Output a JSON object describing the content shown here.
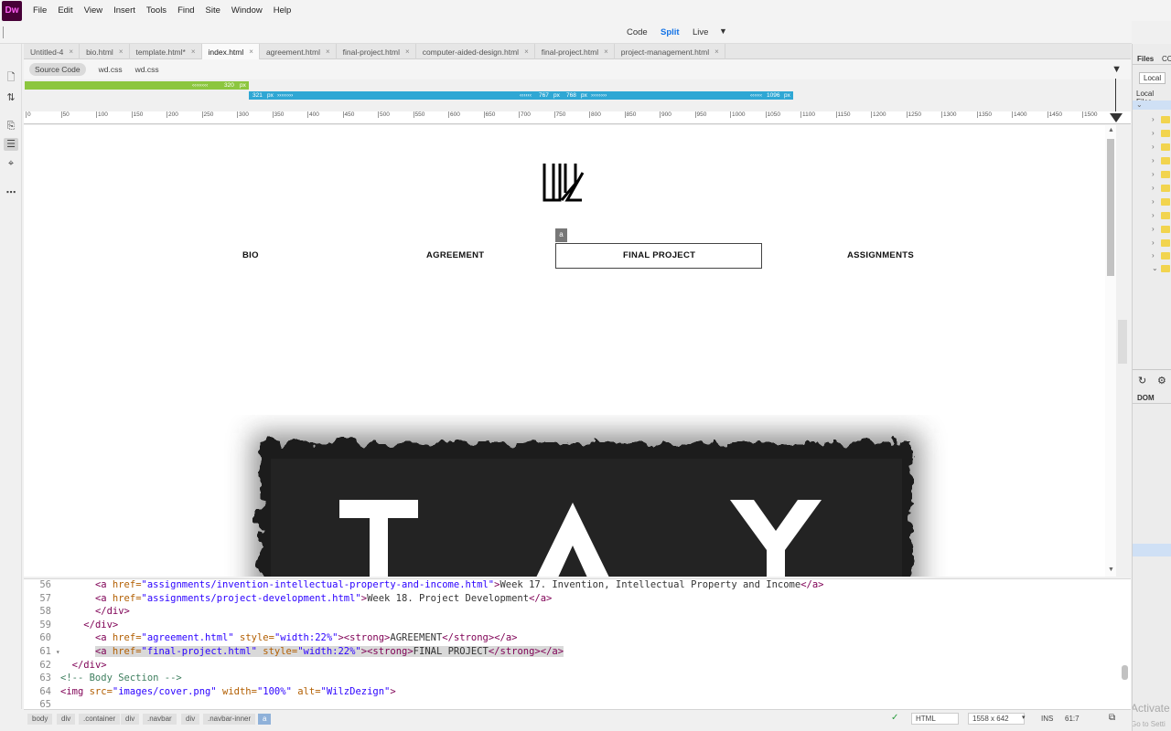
{
  "app": {
    "logo": "Dw"
  },
  "menu": [
    "File",
    "Edit",
    "View",
    "Insert",
    "Tools",
    "Find",
    "Site",
    "Window",
    "Help"
  ],
  "views": {
    "code": "Code",
    "split": "Split",
    "live": "Live"
  },
  "tabs": [
    {
      "label": "Untitled-4",
      "active": false
    },
    {
      "label": "bio.html",
      "active": false
    },
    {
      "label": "template.html*",
      "active": false
    },
    {
      "label": "index.html",
      "active": true
    },
    {
      "label": "agreement.html",
      "active": false
    },
    {
      "label": "final-project.html",
      "active": false
    },
    {
      "label": "computer-aided-design.html",
      "active": false
    },
    {
      "label": "final-project.html",
      "active": false
    },
    {
      "label": "project-management.html",
      "active": false
    }
  ],
  "related_files": [
    "Source Code",
    "wd.css",
    "wd.css"
  ],
  "media_queries": {
    "bar1": {
      "end": "320",
      "unit": "px"
    },
    "bar2": {
      "start": "321",
      "mid_end": "767",
      "mid_start": "768",
      "end": "1096",
      "unit": "px"
    }
  },
  "ruler_ticks": [
    "0",
    "50",
    "100",
    "150",
    "200",
    "250",
    "300",
    "350",
    "400",
    "450",
    "500",
    "550",
    "600",
    "650",
    "700",
    "750",
    "800",
    "850",
    "900",
    "950",
    "1000",
    "1050",
    "1100",
    "1150",
    "1200",
    "1250",
    "1300",
    "1350",
    "1400",
    "1450",
    "1500"
  ],
  "live": {
    "nav": [
      "BIO",
      "AGREEMENT",
      "FINAL PROJECT",
      "ASSIGNMENTS"
    ],
    "badge": "a",
    "cover_text": [
      "T",
      "A",
      "Y"
    ]
  },
  "code_lines": [
    {
      "num": "56",
      "fold": false,
      "indent": "      ",
      "parts": [
        [
          "t",
          "<a "
        ],
        [
          "a",
          "href="
        ],
        [
          "s",
          "\"assignments/invention-intellectual-property-and-income.html\""
        ],
        [
          "t",
          ">"
        ],
        [
          "x",
          "Week 17. Invention, Intellectual Property and Income"
        ],
        [
          "t",
          "</a>"
        ]
      ]
    },
    {
      "num": "57",
      "fold": false,
      "indent": "      ",
      "parts": [
        [
          "t",
          "<a "
        ],
        [
          "a",
          "href="
        ],
        [
          "s",
          "\"assignments/project-development.html\""
        ],
        [
          "t",
          ">"
        ],
        [
          "x",
          "Week 18. Project Development"
        ],
        [
          "t",
          "</a>"
        ]
      ]
    },
    {
      "num": "58",
      "fold": false,
      "indent": "      ",
      "parts": [
        [
          "t",
          "</div>"
        ]
      ]
    },
    {
      "num": "59",
      "fold": false,
      "indent": "    ",
      "parts": [
        [
          "t",
          "</div>"
        ]
      ]
    },
    {
      "num": "60",
      "fold": false,
      "indent": "      ",
      "parts": [
        [
          "t",
          "<a "
        ],
        [
          "a",
          "href="
        ],
        [
          "s",
          "\"agreement.html\""
        ],
        [
          "a",
          " style="
        ],
        [
          "s",
          "\"width:22%\""
        ],
        [
          "t",
          "><strong>"
        ],
        [
          "x",
          "AGREEMENT"
        ],
        [
          "t",
          "</strong></a>"
        ]
      ]
    },
    {
      "num": "61",
      "fold": true,
      "indent": "      ",
      "parts": [
        [
          "t",
          "<a "
        ],
        [
          "a",
          "href="
        ],
        [
          "s",
          "\"final-project.html\""
        ],
        [
          "a",
          " style="
        ],
        [
          "s",
          "\"width:22%\""
        ],
        [
          "t",
          "><strong>"
        ],
        [
          "x",
          "FINAL PROJECT"
        ],
        [
          "t",
          "</strong></a>"
        ]
      ]
    },
    {
      "num": "62",
      "fold": false,
      "indent": "  ",
      "parts": [
        [
          "t",
          "</div>"
        ]
      ]
    },
    {
      "num": "63",
      "fold": false,
      "indent": "",
      "parts": [
        [
          "c",
          "<!-- Body Section -->"
        ]
      ]
    },
    {
      "num": "64",
      "fold": false,
      "indent": "",
      "parts": [
        [
          "t",
          "<img "
        ],
        [
          "a",
          "src="
        ],
        [
          "s",
          "\"images/cover.png\""
        ],
        [
          "a",
          " width="
        ],
        [
          "s",
          "\"100%\""
        ],
        [
          "a",
          " alt="
        ],
        [
          "s",
          "\"WilzDezign\""
        ],
        [
          "t",
          ">"
        ]
      ]
    },
    {
      "num": "65",
      "fold": false,
      "indent": "",
      "parts": []
    }
  ],
  "breadcrumb": [
    "body",
    "div",
    ".container",
    "div",
    ".navbar",
    "div",
    ".navbar-inner",
    "a"
  ],
  "status": {
    "valid": "✓",
    "doc_type": "HTML",
    "size": "1558 x 642",
    "mode": "INS",
    "cursor": "61:7"
  },
  "right_panel": {
    "tab_files": "Files",
    "tab_cc": "CC",
    "local": "Local",
    "local_files": "Local Files",
    "dom": "DOM",
    "activate": "Activate",
    "go_to_settings": "Go to Setti"
  }
}
